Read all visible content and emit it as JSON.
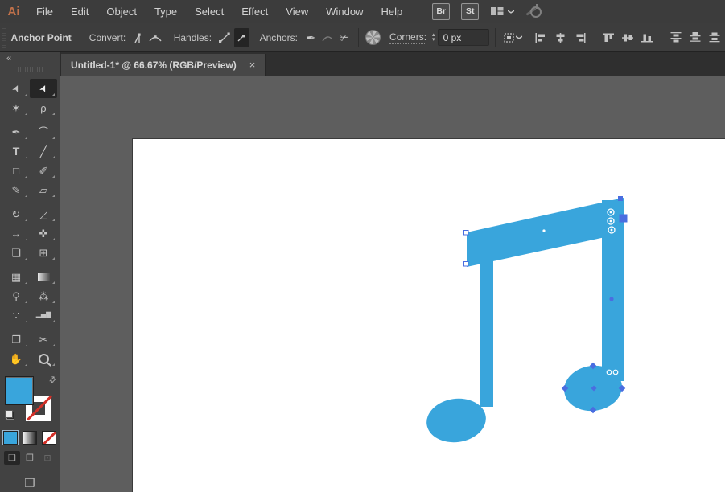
{
  "app": {
    "logo": "Ai",
    "menus": [
      "File",
      "Edit",
      "Object",
      "Type",
      "Select",
      "Effect",
      "View",
      "Window",
      "Help"
    ],
    "bridge_button": "Br",
    "stock_button": "St"
  },
  "control_bar": {
    "title": "Anchor Point",
    "convert_label": "Convert:",
    "handles_label": "Handles:",
    "anchors_label": "Anchors:",
    "anchors_pen_glyph": "✒",
    "anchors_cut_glyph": "✃",
    "corners_label": "Corners:",
    "corners_value": "0 px",
    "stepper_up": "▴",
    "stepper_down": "▾",
    "menu_chevron": "❯"
  },
  "tab_bar": {
    "collapse_glyph": "«",
    "tab_title": "Untitled-1* @ 66.67% (RGB/Preview)",
    "close_glyph": "×"
  },
  "toolbar": {
    "tools": [
      {
        "name": "selection",
        "glyph": "➤"
      },
      {
        "name": "direct-selection",
        "glyph": "➤"
      },
      {
        "name": "magic-wand",
        "glyph": "✶"
      },
      {
        "name": "lasso",
        "glyph": "ρ"
      },
      {
        "name": "pen",
        "glyph": "✒"
      },
      {
        "name": "curvature",
        "glyph": "⌒"
      },
      {
        "name": "type",
        "glyph": "T"
      },
      {
        "name": "line-segment",
        "glyph": "╱"
      },
      {
        "name": "rectangle",
        "glyph": "□"
      },
      {
        "name": "paintbrush",
        "glyph": "✐"
      },
      {
        "name": "shaper",
        "glyph": "✎"
      },
      {
        "name": "eraser",
        "glyph": "▱"
      },
      {
        "name": "rotate",
        "glyph": "↻"
      },
      {
        "name": "scale",
        "glyph": "◿"
      },
      {
        "name": "width",
        "glyph": "↔"
      },
      {
        "name": "puppet-warp",
        "glyph": "✜"
      },
      {
        "name": "shape-builder",
        "glyph": "❏"
      },
      {
        "name": "perspective-grid",
        "glyph": "⊞"
      },
      {
        "name": "mesh",
        "glyph": "▦"
      },
      {
        "name": "gradient",
        "glyph": ""
      },
      {
        "name": "eyedropper",
        "glyph": "⚲"
      },
      {
        "name": "blend",
        "glyph": "⁂"
      },
      {
        "name": "symbol-sprayer",
        "glyph": "∵"
      },
      {
        "name": "column-graph",
        "glyph": "▂▅▇"
      },
      {
        "name": "artboard",
        "glyph": "❐"
      },
      {
        "name": "slice",
        "glyph": "✂"
      },
      {
        "name": "hand",
        "glyph": "✋"
      },
      {
        "name": "zoom",
        "glyph": ""
      }
    ],
    "swap_glyph": "⇄",
    "draw_modes": [
      {
        "name": "draw-normal",
        "glyph": "❑"
      },
      {
        "name": "draw-behind",
        "glyph": "❒"
      },
      {
        "name": "draw-inside",
        "glyph": "⊡"
      }
    ],
    "screen_mode_glyph": "❒"
  },
  "canvas": {
    "artwork": "beamed eighth note shape, selected",
    "fill_color": "#39a5dc",
    "selection_color": "#4a6de0"
  }
}
